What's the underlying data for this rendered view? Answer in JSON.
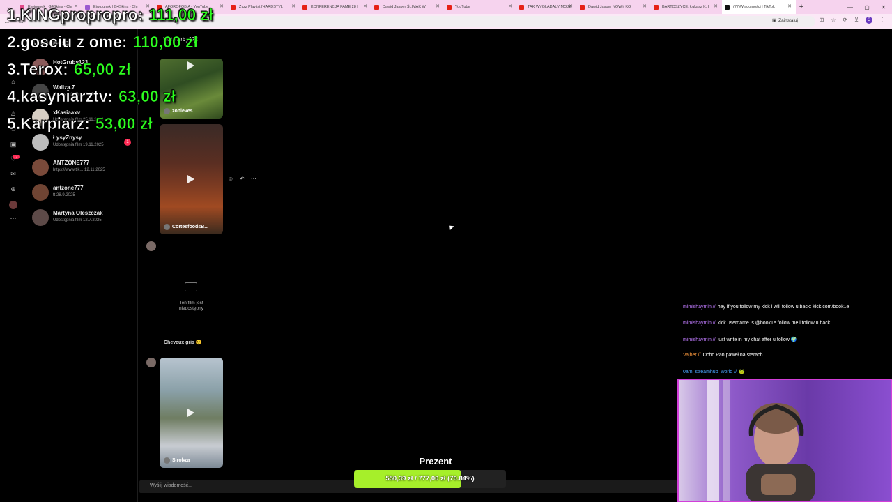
{
  "browser": {
    "tabs": [
      {
        "title": "Eiwipunek | G4Skins - Chr",
        "color": "#e24a8a"
      },
      {
        "title": "Eiwipunek | G4Skins - Chr",
        "color": "#9b59d0"
      },
      {
        "title": "AFOROFOBIA - YouTube",
        "color": "#e62117"
      },
      {
        "title": "Zyzz Playlist [HARDSTYL",
        "color": "#e62117"
      },
      {
        "title": "KONFERENCJA FAME 28 |",
        "color": "#e62117"
      },
      {
        "title": "Dawid Jasper ŚLIMAK W",
        "color": "#e62117"
      },
      {
        "title": "YouTube",
        "color": "#e62117"
      },
      {
        "title": "TAK WYGLĄDAŁY MOJE",
        "color": "#e62117"
      },
      {
        "title": "Dawid Jasper NOWY KO",
        "color": "#e62117"
      },
      {
        "title": "BARTOSZYCE: Łukasz K. I",
        "color": "#e62117"
      },
      {
        "title": "(77)Wiadomości | TikTok",
        "color": "#111111"
      }
    ],
    "install_label": "Zainstaluj",
    "profile_initial": "C"
  },
  "rail": {
    "icons": [
      "tiktok-logo-icon",
      "search-icon",
      "home-icon",
      "explore-icon",
      "following-icon",
      "friends-icon",
      "live-icon",
      "messages-icon",
      "upload-icon",
      "profile-icon",
      "more-icon"
    ],
    "badges": {
      "messages": "77",
      "friends": "64"
    }
  },
  "conversations": [
    {
      "name": "HotGruby123",
      "preview": "",
      "unread": ""
    },
    {
      "name": "Waliza.7",
      "preview": "Udostępnia film 17.12",
      "unread": ""
    },
    {
      "name": "xKasiaaxv",
      "preview": "Udostępnia film 25.11.2025",
      "unread": ""
    },
    {
      "name": "ŁysyZnysy",
      "preview": "Udostępnia film 19.11.2025",
      "unread": "1"
    },
    {
      "name": "ANTZONE777",
      "preview": "https://www.tik... 12.11.2025",
      "unread": ""
    },
    {
      "name": "antzone777",
      "preview": "tt 28.9.2025",
      "unread": ""
    },
    {
      "name": "Martyna Oleszczak",
      "preview": "Udostępnia film 12.7.2025",
      "unread": ""
    }
  ],
  "messages": {
    "header_name": "HotGruby123",
    "videos": [
      {
        "label": "zonleves"
      },
      {
        "label": "CortesfoodsB..."
      },
      {
        "label": "Siroh̶za"
      }
    ],
    "unavailable_text_1": "Ten film jest",
    "unavailable_text_2": "niedostępny",
    "unavailable_label": "Cheveux gris 🙂",
    "composer_placeholder": "Wyślij wiadomość..."
  },
  "leaderboard": [
    {
      "rank_name": "1.KINGpropropro:",
      "amount": "111,00 zł"
    },
    {
      "rank_name": "2.gosciu z ome:",
      "amount": "110,00 zł"
    },
    {
      "rank_name": "3.Terox:",
      "amount": "65,00 zł"
    },
    {
      "rank_name": "4.kasyniarztv:",
      "amount": "63,00 zł"
    },
    {
      "rank_name": "5.Karpiarz:",
      "amount": "53,00 zł"
    }
  ],
  "chat": [
    {
      "user": "mimishaymin //",
      "text": "hey if you follow my kick i will follow u back: kick.com/book1e",
      "color": "purple"
    },
    {
      "user": "mimishaymin //",
      "text": "kick username is @book1e follow me i follow u back",
      "color": "purple"
    },
    {
      "user": "mimishaymin //",
      "text": "just write in my chat after u follow 🌍",
      "color": "purple"
    },
    {
      "user": "Vajher //",
      "text": "Ocho Pan paweł na sterach",
      "color": "orange"
    },
    {
      "user": "0am_streamhub_world //",
      "text": "🐸",
      "color": "blue"
    }
  ],
  "goal": {
    "title": "Prezent",
    "current": "550,39 zł",
    "target": "777,00 zł",
    "percent_label": "(70.84%)",
    "fraction": 0.7084
  }
}
